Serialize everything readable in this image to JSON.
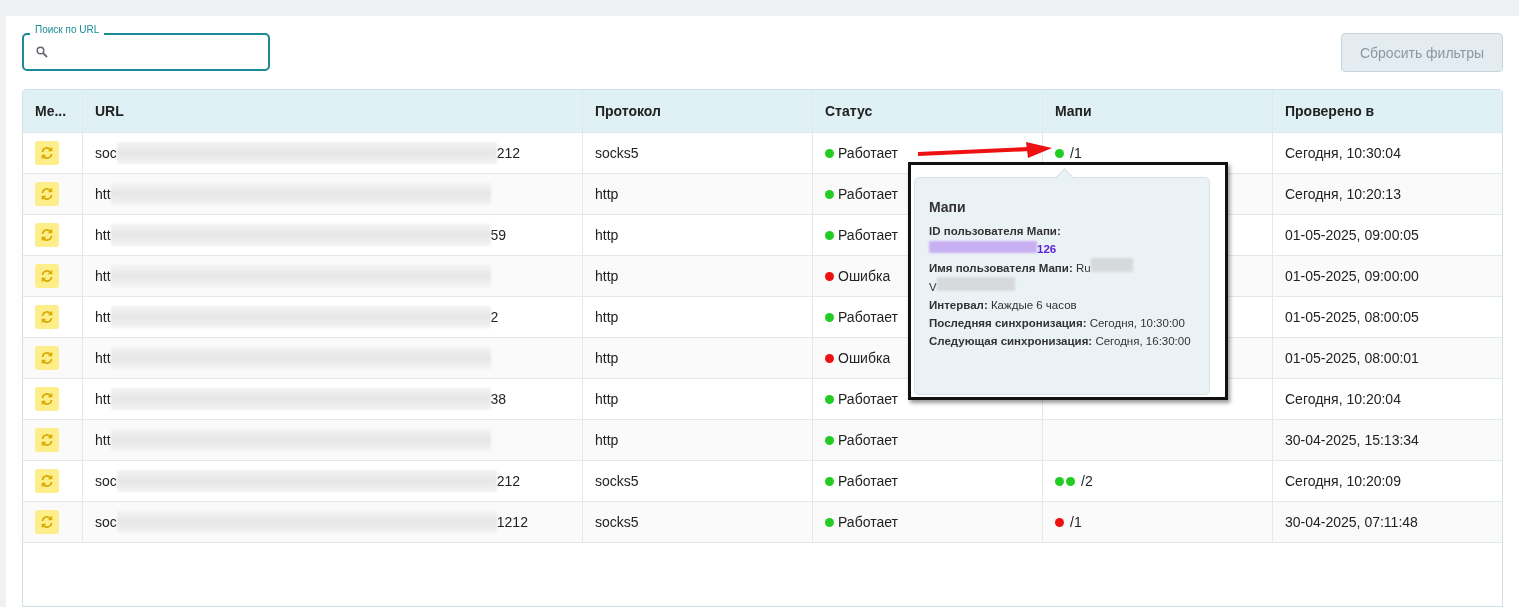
{
  "search": {
    "label": "Поиск по URL"
  },
  "reset_button": "Сбросить фильтры",
  "table": {
    "columns": [
      "Ме...",
      "URL",
      "Протокол",
      "Статус",
      "Мапи",
      "Проверено в"
    ],
    "rows": [
      {
        "url_start": "soc",
        "url_end": "212",
        "protocol": "socks5",
        "status": {
          "text": "Работает",
          "color": "#22cc22"
        },
        "mapi": {
          "dots": [
            {
              "color": "#22cc22"
            }
          ],
          "count": "/1"
        },
        "checked_at": "Сегодня, 10:30:04"
      },
      {
        "url_start": "htt",
        "protocol": "http",
        "status": {
          "text": "Работает",
          "color": "#22cc22"
        },
        "checked_at": "Сегодня, 10:20:13"
      },
      {
        "url_start": "htt",
        "url_end": "59",
        "protocol": "http",
        "status": {
          "text": "Работает",
          "color": "#22cc22"
        },
        "checked_at": "01-05-2025, 09:00:05"
      },
      {
        "url_start": "htt",
        "protocol": "http",
        "status": {
          "text": "Ошибка",
          "color": "#ee1111"
        },
        "checked_at": "01-05-2025, 09:00:00"
      },
      {
        "url_start": "htt",
        "url_end": "2",
        "protocol": "http",
        "status": {
          "text": "Работает",
          "color": "#22cc22"
        },
        "checked_at": "01-05-2025, 08:00:05"
      },
      {
        "url_start": "htt",
        "protocol": "http",
        "status": {
          "text": "Ошибка",
          "color": "#ee1111"
        },
        "checked_at": "01-05-2025, 08:00:01"
      },
      {
        "url_start": "htt",
        "url_end": "38",
        "protocol": "http",
        "status": {
          "text": "Работает",
          "color": "#22cc22"
        },
        "checked_at": "Сегодня, 10:20:04"
      },
      {
        "url_start": "htt",
        "protocol": "http",
        "status": {
          "text": "Работает",
          "color": "#22cc22"
        },
        "checked_at": "30-04-2025, 15:13:34"
      },
      {
        "url_start": "soc",
        "url_end": "212",
        "protocol": "socks5",
        "status": {
          "text": "Работает",
          "color": "#22cc22"
        },
        "mapi": {
          "dots": [
            {
              "color": "#22cc22"
            },
            {
              "color": "#22cc22"
            }
          ],
          "count": "/2"
        },
        "checked_at": "Сегодня, 10:20:09"
      },
      {
        "url_start": "soc",
        "url_end": "1212",
        "protocol": "socks5",
        "status": {
          "text": "Работает",
          "color": "#22cc22"
        },
        "mapi": {
          "dots": [
            {
              "color": "#ee1111"
            }
          ],
          "count": "/1"
        },
        "checked_at": "30-04-2025, 07:11:48"
      }
    ]
  },
  "tooltip": {
    "title": "Мапи",
    "id_label": "ID пользователя Мапи:",
    "id_end": "126",
    "name_label": "Имя пользователя Мапи:",
    "name_start": "Ru",
    "name_second_start": "V",
    "lines": [
      {
        "label": "Интервал:",
        "value": "Каждые 6 часов"
      },
      {
        "label": "Последняя синхронизация:",
        "value": "Сегодня, 10:30:00"
      },
      {
        "label": "Следующая синхронизация:",
        "value": "Сегодня, 16:30:00"
      }
    ]
  }
}
